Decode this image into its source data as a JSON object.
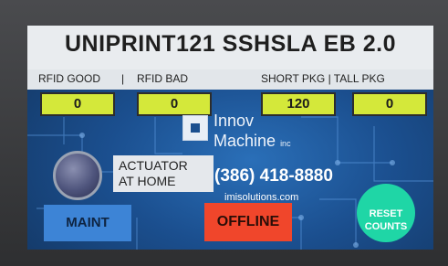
{
  "header": {
    "title": "UNIPRINT121 SSHSLA EB 2.0"
  },
  "labels": {
    "rfid_good": "RFID GOOD",
    "separator1": "|",
    "rfid_bad": "RFID BAD",
    "short_tall": "SHORT PKG | TALL PKG"
  },
  "counters": {
    "rfid_good": "0",
    "rfid_bad": "0",
    "short_pkg": "120",
    "tall_pkg": "0"
  },
  "branding": {
    "name_line1": "Innov",
    "name_line2": "Machine",
    "suffix": "inc",
    "phone": "(386) 418-8880",
    "website": "imisolutions.com"
  },
  "status": {
    "actuator_line1": "ACTUATOR",
    "actuator_line2": "AT HOME"
  },
  "buttons": {
    "maint": "MAINT",
    "offline": "OFFLINE",
    "reset_line1": "RESET",
    "reset_line2": "COUNTS"
  },
  "colors": {
    "counter_fill": "#d4e83a",
    "maint": "#3d84d6",
    "offline": "#f0462b",
    "reset": "#1fd6a6",
    "screen_bg": "#1b4f8f"
  }
}
